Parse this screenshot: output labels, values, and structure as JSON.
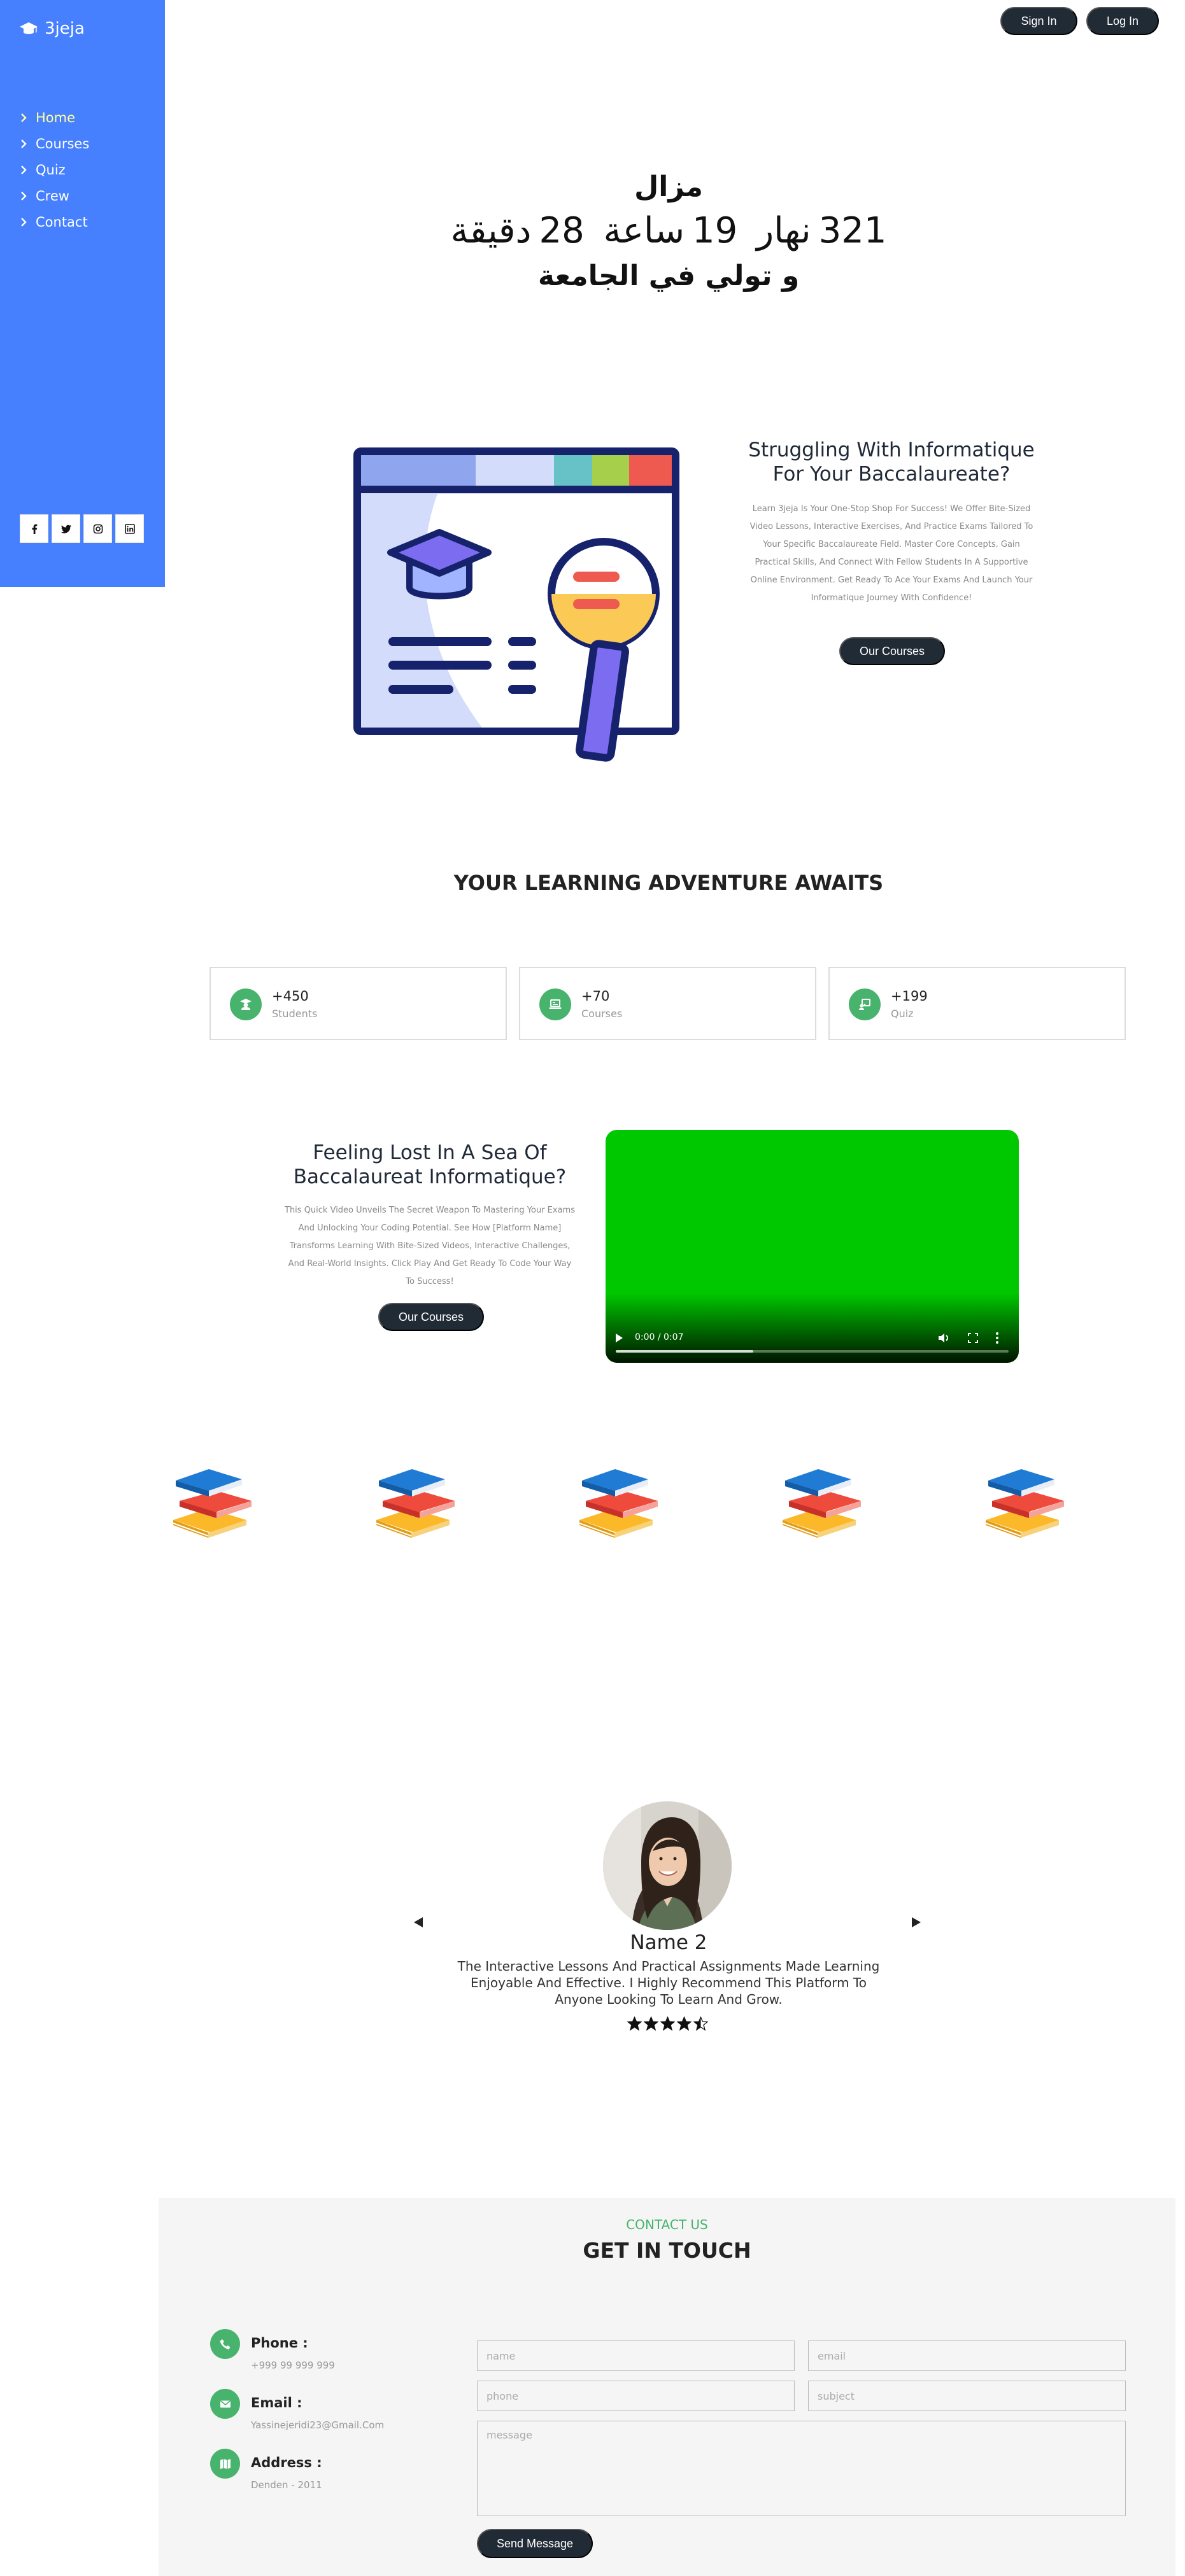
{
  "brand": {
    "name": "3jeja",
    "icon": "graduation-cap-icon"
  },
  "sidebar": {
    "items": [
      {
        "label": "Home",
        "active": true
      },
      {
        "label": "Courses",
        "active": false
      },
      {
        "label": "Quiz",
        "active": false
      },
      {
        "label": "Crew",
        "active": false
      },
      {
        "label": "Contact",
        "active": false
      }
    ],
    "socials": [
      "facebook-icon",
      "twitter-icon",
      "instagram-icon",
      "linkedin-icon"
    ]
  },
  "header": {
    "signin_label": "Sign In",
    "login_label": "Log In"
  },
  "countdown": {
    "line1": "مزال",
    "days_value": "321",
    "days_label": "نهار",
    "hours_value": "19",
    "hours_label": "ساعة",
    "minutes_value": "28",
    "minutes_label": "دقيقة",
    "line3": "و تولي في الجامعة"
  },
  "hero": {
    "title": "Struggling With Informatique For Your Baccalaureate?",
    "description": "Learn 3jeja Is Your One-Stop Shop For Success! We Offer Bite-Sized Video Lessons, Interactive Exercises, And Practice Exams Tailored To Your Specific Baccalaureate Field. Master Core Concepts, Gain Practical Skills, And Connect With Fellow Students In A Supportive Online Environment. Get Ready To Ace Your Exams And Launch Your Informatique Journey With Confidence!",
    "button_label": "Our Courses"
  },
  "adventure": {
    "title": "YOUR LEARNING ADVENTURE AWAITS",
    "stats": [
      {
        "value": "+450",
        "label": "Students",
        "icon": "student-icon"
      },
      {
        "value": "+70",
        "label": "Courses",
        "icon": "laptop-icon"
      },
      {
        "value": "+199",
        "label": "Quiz",
        "icon": "quiz-icon"
      }
    ]
  },
  "video_section": {
    "title": "Feeling Lost In A Sea Of Baccalaureat Informatique?",
    "description": "This Quick Video Unveils The Secret Weapon To Mastering Your Exams And Unlocking Your Coding Potential. See How [Platform Name] Transforms Learning With Bite-Sized Videos, Interactive Challenges, And Real-World Insights. Click Play And Get Ready To Code Your Way To Success!",
    "button_label": "Our Courses",
    "video": {
      "time": "0:00 / 0:07",
      "buffered": 0.35,
      "color": "#00c800"
    }
  },
  "books": {
    "count": 5,
    "icon": "books-stack-icon"
  },
  "testimonial": {
    "name": "Name 2",
    "text": "The Interactive Lessons And Practical Assignments Made Learning Enjoyable And Effective. I Highly Recommend This Platform To Anyone Looking To Learn And Grow.",
    "rating": 4.5,
    "rating_max": 5
  },
  "contact": {
    "eyebrow": "CONTACT US",
    "title": "GET IN TOUCH",
    "info": [
      {
        "label": "Phone :",
        "value": "+999 99 999 999",
        "icon": "phone-icon"
      },
      {
        "label": "Email :",
        "value": "Yassinejeridi23@Gmail.Com",
        "icon": "mail-icon"
      },
      {
        "label": "Address :",
        "value": "Denden - 2011",
        "icon": "map-icon"
      }
    ],
    "form": {
      "name_placeholder": "name",
      "email_placeholder": "email",
      "phone_placeholder": "phone",
      "subject_placeholder": "subject",
      "message_placeholder": "message",
      "submit_label": "Send Message"
    }
  },
  "colors": {
    "sidebar_bg": "#4680ff",
    "active_nav": "#ffff9e",
    "dark_button": "#212b36",
    "accent_green": "#47b36c",
    "contact_bg": "#f5f5f5"
  }
}
